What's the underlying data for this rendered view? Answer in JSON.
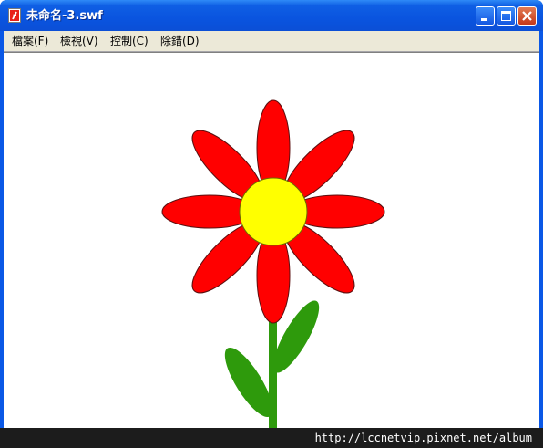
{
  "window": {
    "title": "未命名-3.swf",
    "app_icon": "flash-player-icon",
    "buttons": [
      {
        "name": "minimize-icon"
      },
      {
        "name": "maximize-icon"
      },
      {
        "name": "close-icon"
      }
    ],
    "accent_color": "#0a54df",
    "close_color": "#c4381a"
  },
  "menu": {
    "items": [
      {
        "label": "檔案(F)"
      },
      {
        "label": "檢視(V)"
      },
      {
        "label": "控制(C)"
      },
      {
        "label": "除錯(D)"
      }
    ]
  },
  "canvas": {
    "background": "#ffffff",
    "flower": {
      "petal_color": "#ff0000",
      "center_color": "#ffff00",
      "stem_color": "#2e9a0c",
      "petal_count": 8,
      "leaf_count": 2
    }
  },
  "watermark": {
    "text": "http://lccnetvip.pixnet.net/album"
  }
}
